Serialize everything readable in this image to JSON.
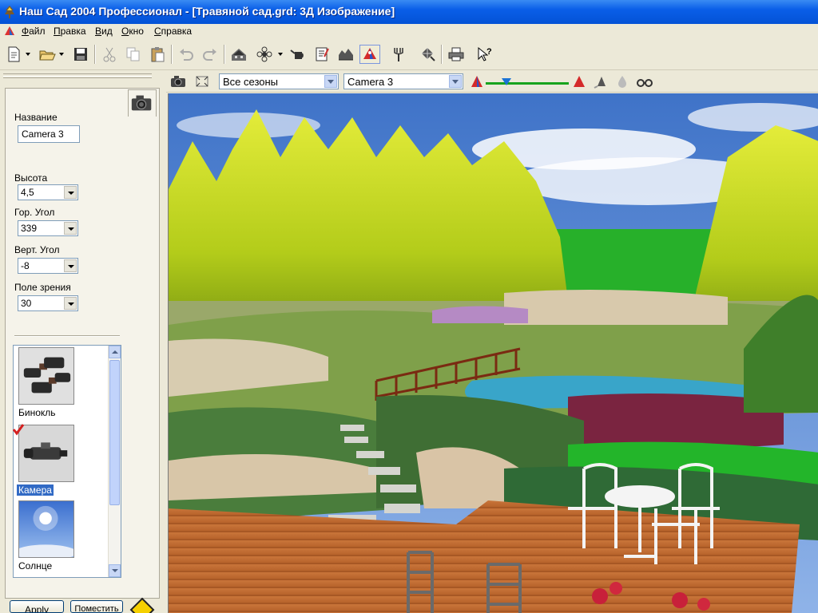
{
  "window": {
    "title": "Наш Сад 2004 Профессионал - [Травяной сад.grd: 3Д Изображение]"
  },
  "menu": {
    "items": [
      "Файл",
      "Правка",
      "Вид",
      "Окно",
      "Справка"
    ]
  },
  "toolbar": {
    "icons": [
      "new-document-icon",
      "open-folder-icon",
      "save-icon",
      "cut-icon",
      "copy-icon",
      "paste-icon",
      "undo-icon",
      "redo-icon",
      "building-icon",
      "flower-icon",
      "watering-can-icon",
      "notes-icon",
      "terrain-icon",
      "3d-view-icon",
      "fork-icon",
      "transform-icon",
      "print-icon",
      "help-icon"
    ]
  },
  "view_toolbar": {
    "season_value": "Все сезоны",
    "camera_value": "Camera 3",
    "zoom_level": 0.25
  },
  "camera_panel": {
    "name_label": "Название",
    "name_value": "Camera 3",
    "height_label": "Высота",
    "height_value": "4,5",
    "hangle_label": "Гор. Угол",
    "hangle_value": "339",
    "vangle_label": "Верт. Угол",
    "vangle_value": "-8",
    "fov_label": "Поле зрения",
    "fov_value": "30",
    "items": [
      {
        "label": "Бинокль",
        "icon": "binoculars-icon",
        "selected": false
      },
      {
        "label": "Камера",
        "icon": "video-camera-icon",
        "selected": true
      },
      {
        "label": "Солнце",
        "icon": "sun-icon",
        "selected": false
      }
    ],
    "apply_label": "Apply",
    "place_label": "Поместить"
  }
}
